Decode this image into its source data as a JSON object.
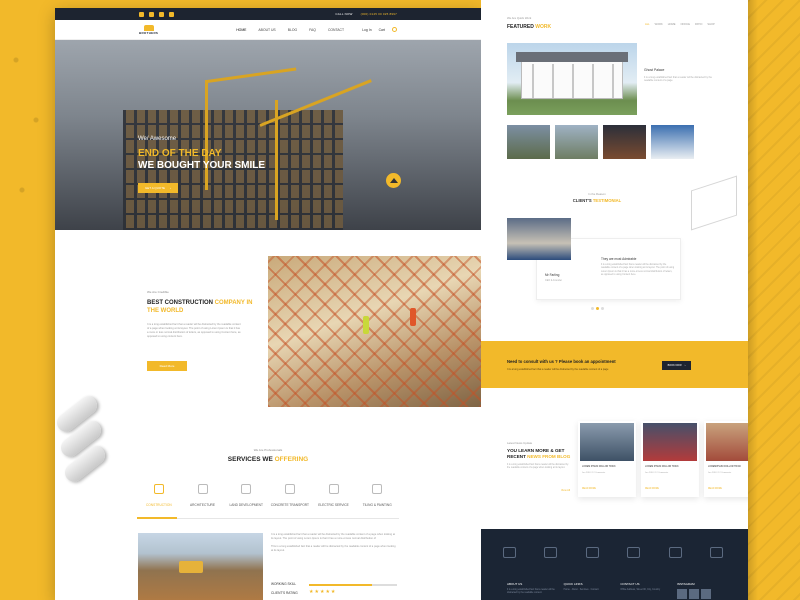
{
  "left_page": {
    "topbar": {
      "call_label": "CALL NOW",
      "phone": "(000) 0145 00 025 8997"
    },
    "navbar": {
      "logo_text": "BROTHERS",
      "menu": [
        "HOME",
        "ABOUT US",
        "BLOG",
        "FAQ",
        "CONTACT"
      ],
      "login_label": "Log In",
      "cart_label": "Cart"
    },
    "hero": {
      "subtitle": "We/ Awesome",
      "title_line1": "END OF THE DAY",
      "title_line2": "WE BOUGHT YOUR SMILE",
      "button_label": "GET A QUOTE"
    },
    "about": {
      "eyebrow": "We Are Credible",
      "title_part1": "BEST CONSTRUCTION ",
      "title_highlight": "COMPANY IN THE WORLD",
      "text": "It is a long established fact that a reader will be distracted by the readable content of a page when looking at its layout. The point of using Lorem Ipsum is that it has a more or less normal distribution of letters, as opposed to using Content here, as opposed to using content here.",
      "button_label": "Read More"
    },
    "services": {
      "eyebrow": "We Are Professionals",
      "title_part1": "SERVICES WE ",
      "title_highlight": "OFFERING",
      "tabs": [
        {
          "label": "CONSTRUCTION",
          "icon": "building-icon"
        },
        {
          "label": "ARCHITECTURE",
          "icon": "monitor-icon"
        },
        {
          "label": "LAND DEVELOPMENT",
          "icon": "layers-icon"
        },
        {
          "label": "CONCRETE TRANSPORT",
          "icon": "truck-icon"
        },
        {
          "label": "ELECTRIC SERVICE",
          "icon": "gear-icon"
        },
        {
          "label": "TILING & PAINTING",
          "icon": "paint-roller-icon"
        }
      ],
      "text_p1": "It is a long established fact that a reader will be distracted by the readable content of a page when looking at its layout. The point of using Lorem Ipsum is that it has a more-or-less normal distribution of",
      "text_p2": "This is a long established fact that a reader will be distracted by the readable content of a page when looking at its layout.",
      "working_skill_label": "WORKING SKILL",
      "working_skill_value": 0.72,
      "clients_rating_label": "CLIENT'S RATING",
      "clients_rating_value": 5,
      "clients_rating_stars": "★★★★★"
    }
  },
  "right_page": {
    "featured": {
      "eyebrow": "We Are Quick Work",
      "title_part1": "FEATURED ",
      "title_highlight": "WORK",
      "filters": [
        "ALL",
        "WORK",
        "HOME",
        "OFFICE",
        "PATIO",
        "SHOP"
      ],
      "item_title": "Ghost Palace",
      "item_desc": "It is a long established fact that a reader will be distracted by the readable content of a page."
    },
    "testimonial": {
      "eyebrow": "In the Reason",
      "title_part1": "CLIENT'S ",
      "title_highlight": "TESTIMONIAL",
      "name": "Mr Farling",
      "role": "CEO & Founder",
      "quote_title": "They are most Admirable",
      "quote": "It is a long established fact that a reader will be distracted by the readable content of a page when looking at its layout. The point of using Lorem Ipsum is that it has a more-or-less normal distribution of letters, as opposed to using Content here."
    },
    "cta": {
      "title": "Need to consult with us ? Please book an appointment",
      "subtitle": "It is a long established fact that a reader will be distracted by the readable content of a page",
      "button_label": "BOOK NOW"
    },
    "blog": {
      "eyebrow": "Latest News Update",
      "title_part1": "YOU LEARN MORE & GET RECENT ",
      "title_highlight": "NEWS FROM BLOG",
      "text": "It is a long established fact that a reader will be distracted by the readable content of a page when looking at its layout.",
      "more_label": "View All",
      "cards": [
        {
          "title": "LOREM IPSUM DOLLOR TRICK",
          "date": "Jan 2018 / 12 Comments",
          "read": "READ MORE"
        },
        {
          "title": "LOREM IPSUM DOLLOR TRICK",
          "date": "Jan 2018 / 12 Comments",
          "read": "READ MORE"
        },
        {
          "title": "LOREMIPSUM DOLLOR TRICK",
          "date": "Jan 2018 / 12 Comments",
          "read": "READ MORE"
        }
      ]
    },
    "footer": {
      "columns": [
        {
          "heading": "ABOUT US",
          "text": "It is a long established fact that a reader will be distracted by the readable content."
        },
        {
          "heading": "QUICK LINKS",
          "text": "Home · About · Services · Contact"
        },
        {
          "heading": "CONTACT US",
          "text": "Office Address, Street 00, City, Country"
        },
        {
          "heading": "INSTAGRAM",
          "text": ""
        }
      ]
    }
  }
}
